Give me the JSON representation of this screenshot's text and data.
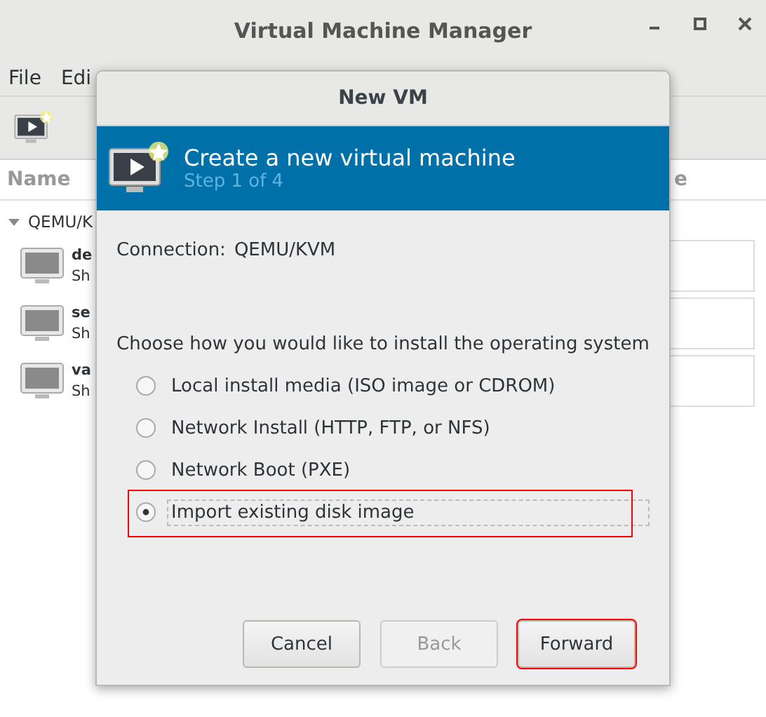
{
  "window": {
    "title": "Virtual Machine Manager"
  },
  "menu": [
    "File",
    "Edi"
  ],
  "list": {
    "column_1": "Name",
    "column_2": "e",
    "connection": {
      "label": "QEMU/K",
      "expanded": true
    },
    "vms": [
      {
        "name": "de",
        "status": "Sh"
      },
      {
        "name": "se",
        "status": "Sh"
      },
      {
        "name": "va",
        "status": "Sh"
      }
    ]
  },
  "dialog": {
    "title": "New VM",
    "heading": "Create a new virtual machine",
    "step": "Step 1 of 4",
    "connection_label": "Connection:",
    "connection": "QEMU/KVM",
    "prompt": "Choose how you would like to install the operating system",
    "options": [
      {
        "label": "Local install media (ISO image or CDROM)",
        "selected": false,
        "focused": false,
        "highlighted": false
      },
      {
        "label": "Network Install (HTTP, FTP, or NFS)",
        "selected": false,
        "focused": false,
        "highlighted": false
      },
      {
        "label": "Network Boot (PXE)",
        "selected": false,
        "focused": false,
        "highlighted": false
      },
      {
        "label": "Import existing disk image",
        "selected": true,
        "focused": true,
        "highlighted": true
      }
    ],
    "buttons": [
      {
        "label": "Cancel",
        "disabled": false,
        "highlighted": false
      },
      {
        "label": "Back",
        "disabled": true,
        "highlighted": false
      },
      {
        "label": "Forward",
        "disabled": false,
        "highlighted": true
      }
    ]
  }
}
